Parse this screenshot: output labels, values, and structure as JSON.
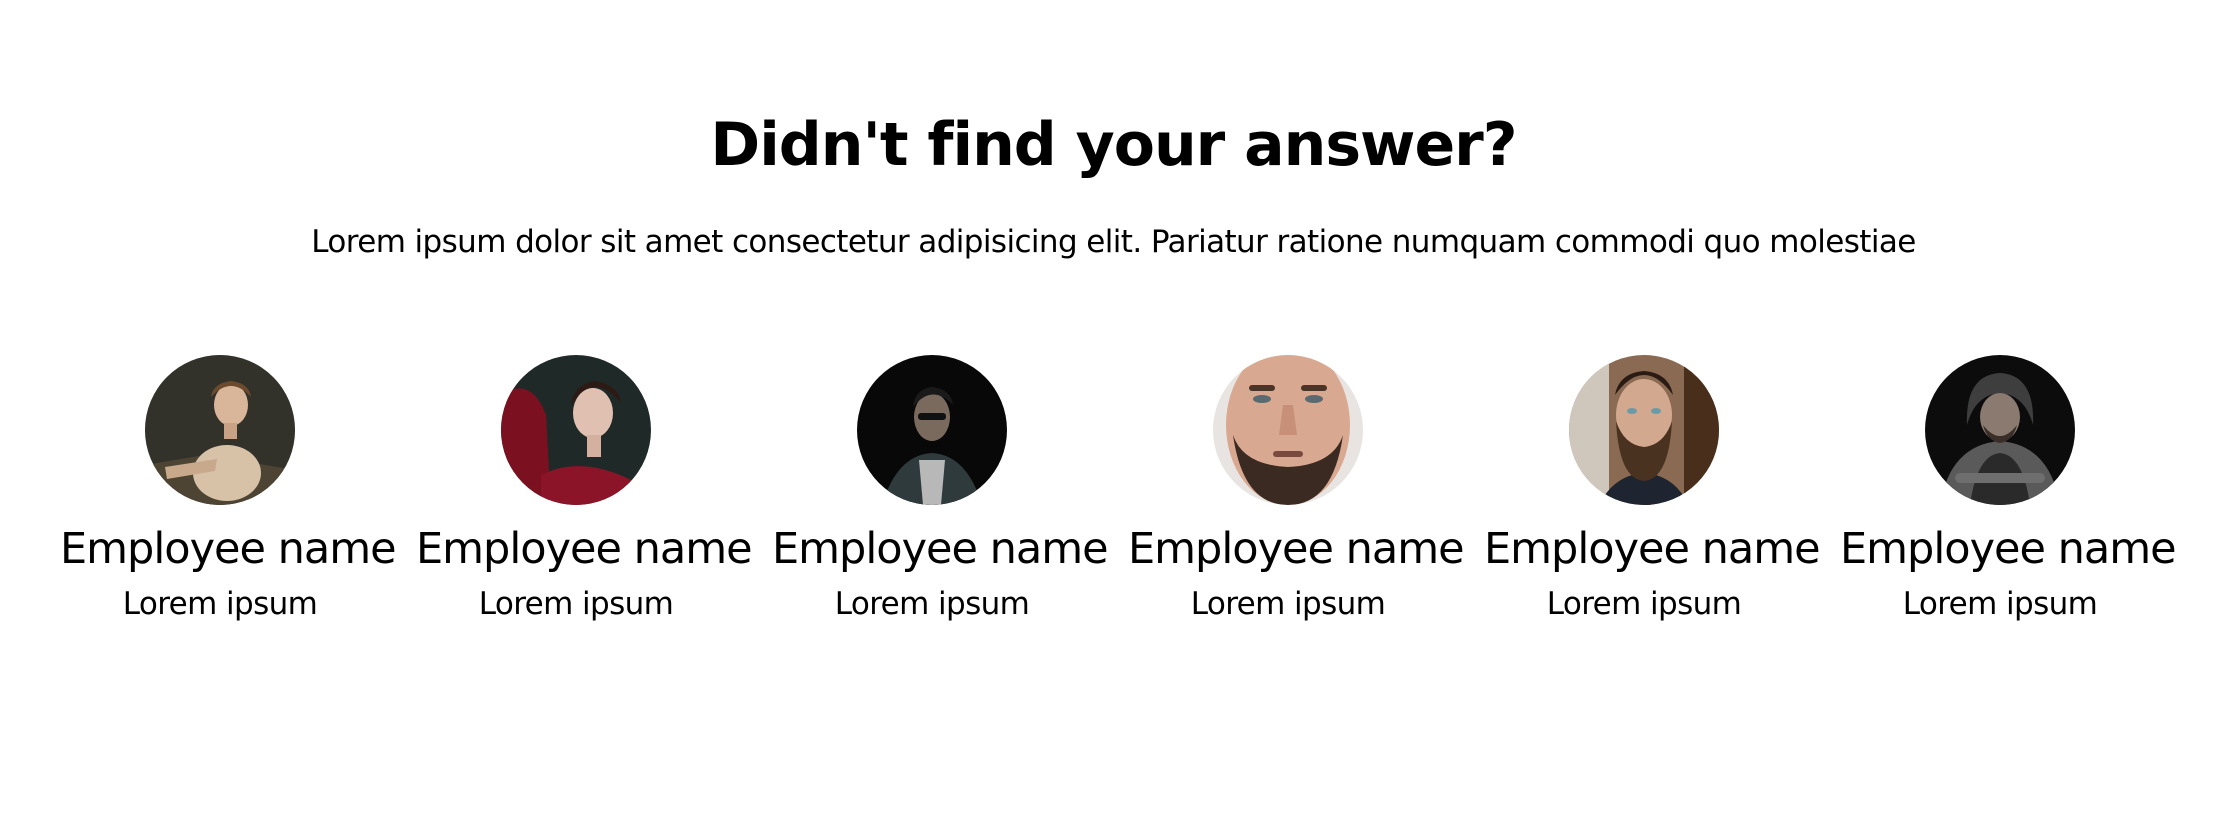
{
  "section": {
    "title": "Didn't find your answer?",
    "subtitle": "Lorem ipsum dolor sit amet consectetur adipisicing elit. Pariatur ratione numquam commodi quo molestiae"
  },
  "team": [
    {
      "name": "Employee name",
      "role": "Lorem ipsum",
      "avatar": "woman-portrait-photo"
    },
    {
      "name": "Employee name",
      "role": "Lorem ipsum",
      "avatar": "woman-red-dress-photo"
    },
    {
      "name": "Employee name",
      "role": "Lorem ipsum",
      "avatar": "man-sunglasses-photo"
    },
    {
      "name": "Employee name",
      "role": "Lorem ipsum",
      "avatar": "man-beard-closeup-photo"
    },
    {
      "name": "Employee name",
      "role": "Lorem ipsum",
      "avatar": "man-full-beard-photo"
    },
    {
      "name": "Employee name",
      "role": "Lorem ipsum",
      "avatar": "man-hoodie-photo"
    }
  ]
}
